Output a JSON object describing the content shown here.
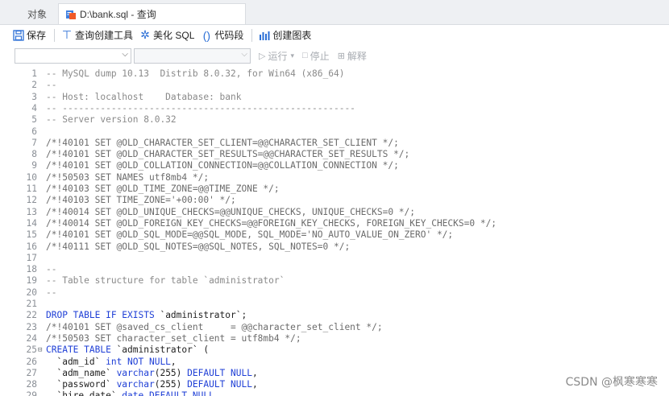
{
  "tabs": {
    "objects_label": "对象",
    "query_label": "D:\\bank.sql - 查询"
  },
  "toolbar": {
    "save_label": "保存",
    "query_builder_label": "查询创建工具",
    "beautify_label": "美化 SQL",
    "code_snippet_label": "代码段",
    "create_chart_label": "创建图表"
  },
  "toolbar2": {
    "connection_value": "",
    "database_value": "",
    "run_label": "运行",
    "stop_label": "停止",
    "explain_label": "解释"
  },
  "colors": {
    "keyword": "#1f3fd6",
    "comment": "#8a8a8a",
    "string": "#c2187a",
    "accent": "#2b6fd6"
  },
  "editor": {
    "lines": [
      {
        "n": "1",
        "fold": "",
        "html": "<span class=\"cm\">-- MySQL dump 10.13  Distrib 8.0.32, for Win64 (x86_64)</span>"
      },
      {
        "n": "2",
        "fold": "",
        "html": "<span class=\"cm\">--</span>"
      },
      {
        "n": "3",
        "fold": "",
        "html": "<span class=\"cm\">-- Host: localhost    Database: bank</span>"
      },
      {
        "n": "4",
        "fold": "",
        "html": "<span class=\"cm\">-- ------------------------------------------------------</span>"
      },
      {
        "n": "5",
        "fold": "",
        "html": "<span class=\"cm\">-- Server version 8.0.32</span>"
      },
      {
        "n": "6",
        "fold": "",
        "html": ""
      },
      {
        "n": "7",
        "fold": "",
        "html": "<span class=\"mc\">/*!40101 SET @OLD_CHARACTER_SET_CLIENT=@@CHARACTER_SET_CLIENT */;</span>"
      },
      {
        "n": "8",
        "fold": "",
        "html": "<span class=\"mc\">/*!40101 SET @OLD_CHARACTER_SET_RESULTS=@@CHARACTER_SET_RESULTS */;</span>"
      },
      {
        "n": "9",
        "fold": "",
        "html": "<span class=\"mc\">/*!40101 SET @OLD_COLLATION_CONNECTION=@@COLLATION_CONNECTION */;</span>"
      },
      {
        "n": "10",
        "fold": "",
        "html": "<span class=\"mc\">/*!50503 SET NAMES utf8mb4 */;</span>"
      },
      {
        "n": "11",
        "fold": "",
        "html": "<span class=\"mc\">/*!40103 SET @OLD_TIME_ZONE=@@TIME_ZONE */;</span>"
      },
      {
        "n": "12",
        "fold": "",
        "html": "<span class=\"mc\">/*!40103 SET TIME_ZONE='+00:00' */;</span>"
      },
      {
        "n": "13",
        "fold": "",
        "html": "<span class=\"mc\">/*!40014 SET @OLD_UNIQUE_CHECKS=@@UNIQUE_CHECKS, UNIQUE_CHECKS=0 */;</span>"
      },
      {
        "n": "14",
        "fold": "",
        "html": "<span class=\"mc\">/*!40014 SET @OLD_FOREIGN_KEY_CHECKS=@@FOREIGN_KEY_CHECKS, FOREIGN_KEY_CHECKS=0 */;</span>"
      },
      {
        "n": "15",
        "fold": "",
        "html": "<span class=\"mc\">/*!40101 SET @OLD_SQL_MODE=@@SQL_MODE, SQL_MODE='NO_AUTO_VALUE_ON_ZERO' */;</span>"
      },
      {
        "n": "16",
        "fold": "",
        "html": "<span class=\"mc\">/*!40111 SET @OLD_SQL_NOTES=@@SQL_NOTES, SQL_NOTES=0 */;</span>"
      },
      {
        "n": "17",
        "fold": "",
        "html": ""
      },
      {
        "n": "18",
        "fold": "",
        "html": "<span class=\"cm\">--</span>"
      },
      {
        "n": "19",
        "fold": "",
        "html": "<span class=\"cm\">-- Table structure for table `administrator`</span>"
      },
      {
        "n": "20",
        "fold": "",
        "html": "<span class=\"cm\">--</span>"
      },
      {
        "n": "21",
        "fold": "",
        "html": ""
      },
      {
        "n": "22",
        "fold": "",
        "html": "<span class=\"kw\">DROP TABLE IF EXISTS</span> `administrator`;"
      },
      {
        "n": "23",
        "fold": "",
        "html": "<span class=\"mc\">/*!40101 SET @saved_cs_client     = @@character_set_client */;</span>"
      },
      {
        "n": "24",
        "fold": "",
        "html": "<span class=\"mc\">/*!50503 SET character_set_client = utf8mb4 */;</span>"
      },
      {
        "n": "25",
        "fold": "⊟",
        "html": "<span class=\"kw\">CREATE TABLE</span> `administrator` ("
      },
      {
        "n": "26",
        "fold": "",
        "html": "  `adm_id` <span class=\"kw\">int NOT NULL</span>,"
      },
      {
        "n": "27",
        "fold": "",
        "html": "  `adm_name` <span class=\"kw\">varchar</span>(255) <span class=\"kw\">DEFAULT NULL</span>,"
      },
      {
        "n": "28",
        "fold": "",
        "html": "  `password` <span class=\"kw\">varchar</span>(255) <span class=\"kw\">DEFAULT NULL</span>,"
      },
      {
        "n": "29",
        "fold": "",
        "html": "  `hire_date` <span class=\"kw\">date DEFAULT NULL</span>,"
      }
    ]
  },
  "watermark": "CSDN @枫寒寒寒"
}
